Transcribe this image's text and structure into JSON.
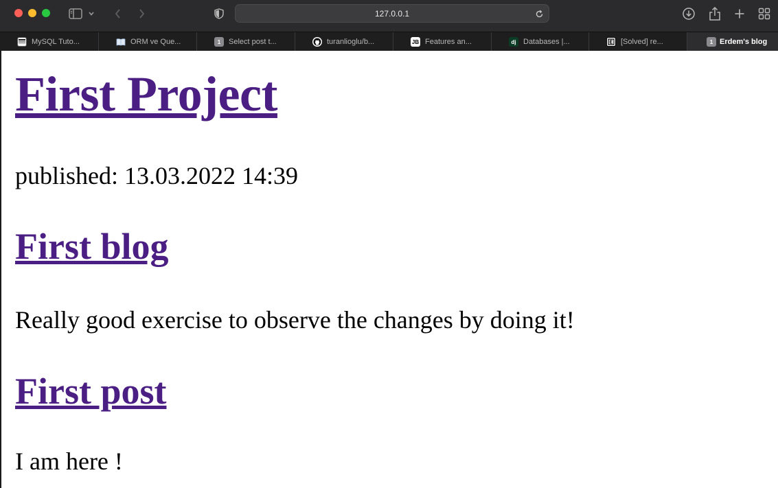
{
  "browser": {
    "address": "127.0.0.1",
    "icons": {
      "sidebar": "sidebar-icon",
      "back": "chevron-left-icon",
      "forward": "chevron-right-icon",
      "privacy": "shield-icon",
      "reload": "reload-icon",
      "downloads": "download-icon",
      "share": "share-icon",
      "new_tab": "plus-icon",
      "tab_overview": "grid-icon"
    },
    "tabs": [
      {
        "label": "MySQL Tuto...",
        "favicon": "",
        "active": false
      },
      {
        "label": "ORM ve Que...",
        "favicon": "",
        "active": false
      },
      {
        "label": "Select post t...",
        "favicon": "1",
        "active": false
      },
      {
        "label": "turanlioglu/b...",
        "favicon": "",
        "active": false
      },
      {
        "label": "Features an...",
        "favicon": "JB",
        "active": false
      },
      {
        "label": "Databases |...",
        "favicon": "dj",
        "active": false
      },
      {
        "label": "[Solved] re...",
        "favicon": "",
        "active": false
      },
      {
        "label": "Erdem's blog",
        "favicon": "1",
        "active": true
      }
    ]
  },
  "page": {
    "project_title": "First Project",
    "published": "published: 13.03.2022 14:39",
    "blog_title": "First blog",
    "blog_text": "Really good exercise to observe the changes by doing it!",
    "post_title": "First post",
    "post_text": "I am here !"
  },
  "colors": {
    "link": "#4a1e82",
    "toolbar_bg": "#2b2b2d",
    "tabstrip_bg": "#1e1e1f"
  }
}
